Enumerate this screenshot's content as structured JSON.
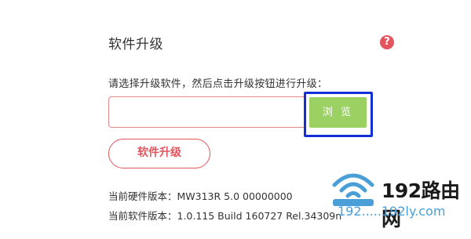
{
  "page": {
    "title": "软件升级",
    "help_icon": "?",
    "instruction": "请选择升级软件，然后点击升级按钮进行升级：",
    "file_input": {
      "value": ""
    },
    "browse_label": "浏 览",
    "upgrade_label": "软件升级",
    "hardware_version": "当前硬件版本：MW313R 5.0 00000000",
    "software_version": "当前软件版本：1.0.115 Build 160727 Rel.34309n"
  },
  "watermark": {
    "brand": "192路由网",
    "url": "192.....192ly.com",
    "icon": "wifi-router-icon"
  },
  "colors": {
    "accent": "#e4545c",
    "browse_green": "#9bd163",
    "highlight_blue": "#1330d6",
    "watermark_blue": "#4a9fd8"
  }
}
